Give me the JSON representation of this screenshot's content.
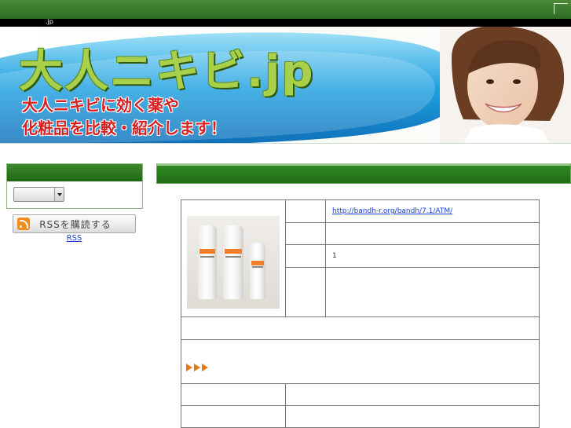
{
  "header": {
    "subbar_text": ".jp"
  },
  "banner": {
    "title": "大人ニキビ.jp",
    "subtitle_line1": "大人ニキビに効く薬や",
    "subtitle_line2": "化粧品を比較・紹介します！",
    "colors": {
      "title_green": "#a8d04a",
      "subtitle_red": "#d81e1e",
      "swoosh_blue": "#1a8fd6"
    }
  },
  "sidebar": {
    "select_value": "",
    "rss_button_label": "RSSを購読する",
    "rss_link_label": "RSS"
  },
  "product": {
    "url": "http://bandh-r.org/bandh/7.1/ATM/",
    "quantity": "1",
    "more_arrows": "▶▶▶",
    "more_link": ""
  },
  "colors": {
    "header_green": "#2e6b22",
    "link_blue": "#1a3ed6",
    "arrow_orange": "#e07a1c"
  }
}
